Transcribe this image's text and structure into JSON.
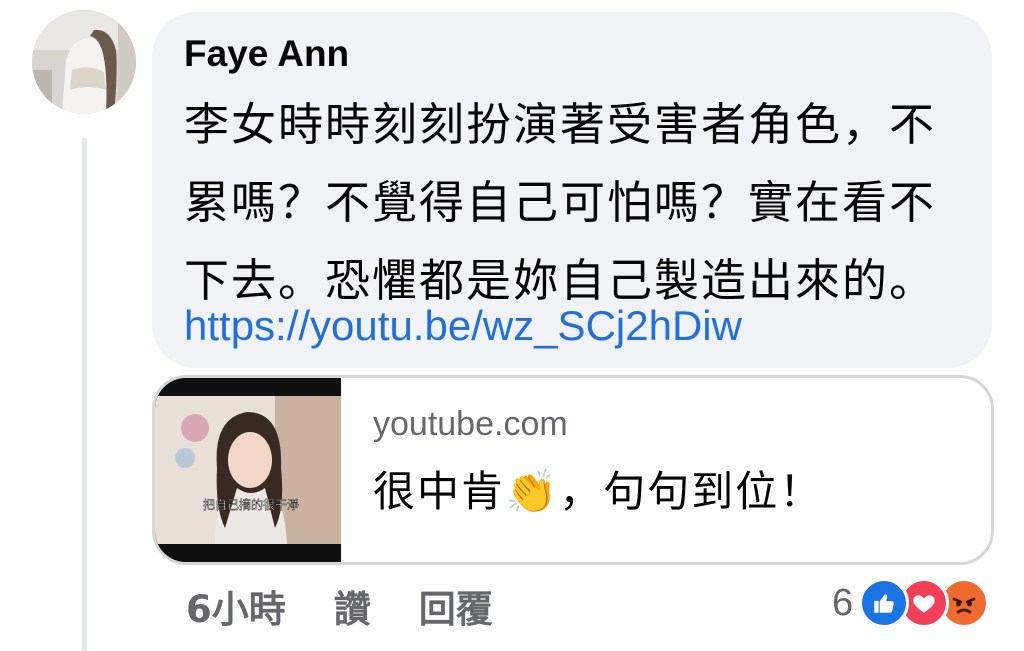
{
  "comment": {
    "author": "Faye Ann",
    "text_lines": [
      "李女時時刻刻扮演著受害者角色，不",
      "累嗎？不覺得自己可怕嗎？實在看不",
      "下去。恐懼都是妳自己製造出來的。"
    ],
    "link": "https://youtu.be/wz_SCj2hDiw"
  },
  "preview": {
    "domain": "youtube.com",
    "title": "很中肯👏，句句到位！",
    "thumbnail_caption": "把自己摘的很干淨"
  },
  "actions": {
    "time": "6小時",
    "like": "讚",
    "reply": "回覆"
  },
  "reactions": {
    "count": "6",
    "icons": [
      "like-icon",
      "love-icon",
      "angry-icon"
    ],
    "colors": {
      "like": "#1b74e4",
      "love": "#f33e58",
      "angry": "#f06a2e"
    }
  },
  "colors": {
    "bubble": "#f0f2f5",
    "link": "#216fdb",
    "secondary_text": "#65676b"
  }
}
